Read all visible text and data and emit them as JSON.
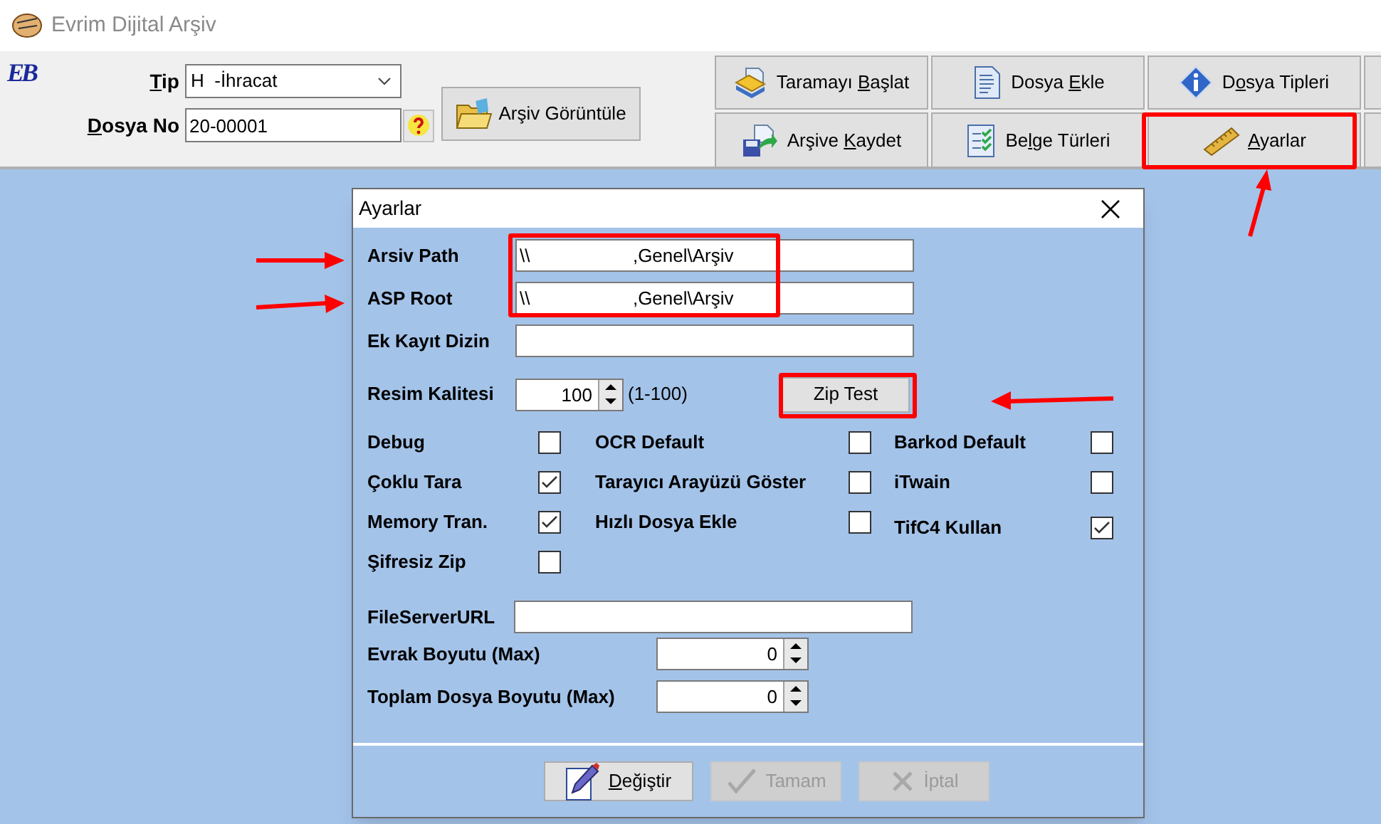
{
  "window": {
    "title": "Evrim Dijital Arşiv"
  },
  "header": {
    "logo": "EB",
    "tip": {
      "label": {
        "key": "T",
        "post": "ip"
      },
      "value": "H  -İhracat"
    },
    "dosya_no": {
      "label": {
        "key": "D",
        "post": "osya No"
      },
      "value": "20-00001"
    },
    "view_button": "Arşiv Görüntüle"
  },
  "toolbar": [
    {
      "kind": "action",
      "label": {
        "pre": "Taramayı ",
        "key": "B",
        "post": "aşlat"
      }
    },
    {
      "kind": "action",
      "label": {
        "pre": "Dosya ",
        "key": "E",
        "post": "kle"
      }
    },
    {
      "kind": "action",
      "label": {
        "pre": "D",
        "key": "o",
        "post": "sya Tipleri"
      }
    },
    {
      "kind": "blank"
    },
    {
      "kind": "action",
      "label": {
        "pre": "Arşive ",
        "key": "K",
        "post": "aydet"
      }
    },
    {
      "kind": "action",
      "label": {
        "pre": "Be",
        "key": "l",
        "post": "ge Türleri"
      }
    },
    {
      "kind": "action",
      "label": {
        "key": "A",
        "post": "yarlar"
      }
    },
    {
      "kind": "blank"
    }
  ],
  "dialog": {
    "title": "Ayarlar",
    "fields": [
      {
        "label": "Arsiv Path",
        "value": "\\\\                    ,Genel\\Arşiv"
      },
      {
        "label": "ASP Root",
        "value": "\\\\                    ,Genel\\Arşiv"
      },
      {
        "label": "Ek Kayıt Dizin"
      }
    ],
    "quality": {
      "label": "Resim Kalitesi",
      "value": "100",
      "hint": "(1-100)"
    },
    "zip_button": "Zip Test",
    "checkbox_columns": [
      [
        {
          "label": "Debug",
          "checked": false
        },
        {
          "label": "Çoklu Tara",
          "checked": true
        },
        {
          "label": "Memory Tran.",
          "checked": true
        },
        {
          "label": "Şifresiz Zip",
          "checked": false
        }
      ],
      [
        {
          "label": "OCR Default",
          "checked": false
        },
        {
          "label": "Tarayıcı Arayüzü Göster",
          "checked": false
        },
        {
          "label": "Hızlı Dosya Ekle",
          "checked": false
        }
      ],
      [
        {
          "label": "Barkod Default",
          "checked": false
        },
        {
          "label": "iTwain",
          "checked": false
        },
        {
          "label": "TifC4 Kullan",
          "checked": true
        }
      ]
    ],
    "file_server": {
      "label": "FileServerURL"
    },
    "spinners": [
      {
        "label": "Evrak Boyutu (Max)",
        "value": "0"
      },
      {
        "label": "Toplam Dosya Boyutu (Max)",
        "value": "0"
      }
    ],
    "buttons": [
      {
        "label": {
          "key": "D",
          "post": "eğiştir"
        },
        "disabled": false
      },
      {
        "label": {
          "pre": "Tamam"
        },
        "disabled": true
      },
      {
        "label": {
          "pre": "İptal"
        },
        "disabled": true
      }
    ]
  }
}
